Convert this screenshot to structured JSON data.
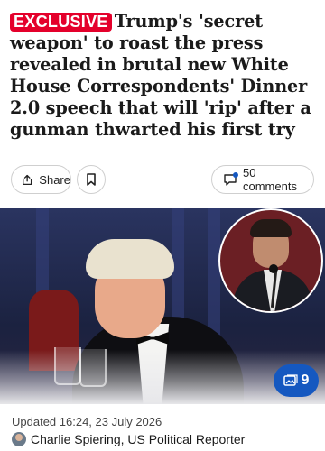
{
  "article": {
    "badge": "EXCLUSIVE",
    "headline": "Trump's 'secret weapon' to roast the press revealed in brutal new White House Correspondents' Dinner 2.0 speech that will 'rip' after a gunman thwarted his first try"
  },
  "actions": {
    "share_label": "Share",
    "comments_label": "50 comments",
    "share_icon": "share-icon",
    "bookmark_icon": "bookmark-icon",
    "comment_icon": "comment-icon"
  },
  "media": {
    "gallery_count": "9",
    "gallery_icon": "image-gallery-icon"
  },
  "byline": {
    "updated": "Updated 16:24, 23 July 2026",
    "author": "Charlie Spiering, US Political Reporter"
  },
  "colors": {
    "badge_red": "#e4002b",
    "gallery_blue": "#1558c0"
  }
}
